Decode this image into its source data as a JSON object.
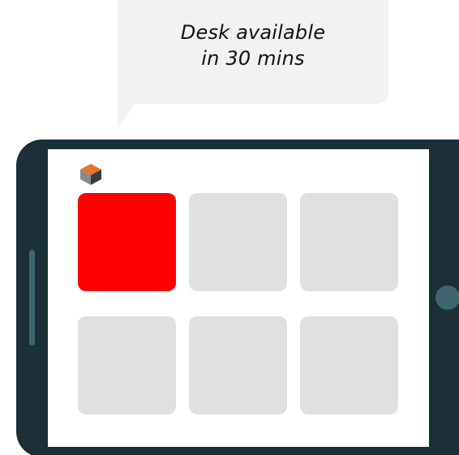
{
  "notification": {
    "line1": "Desk available",
    "line2": "in 30 mins"
  },
  "colors": {
    "tablet_frame": "#1b2f37",
    "tablet_accent": "#3f6670",
    "bubble_bg": "#f2f2f2",
    "desk_free": "#e0e0e0",
    "desk_occupied": "#ff0000",
    "logo_orange": "#e8742c",
    "logo_gray": "#8a8a8a",
    "logo_dark": "#3a3a3a"
  },
  "logo": {
    "icon": "cube-logo-icon"
  },
  "desks": [
    {
      "status": "occupied"
    },
    {
      "status": "free"
    },
    {
      "status": "free"
    },
    {
      "status": "free"
    },
    {
      "status": "free"
    },
    {
      "status": "free"
    }
  ]
}
